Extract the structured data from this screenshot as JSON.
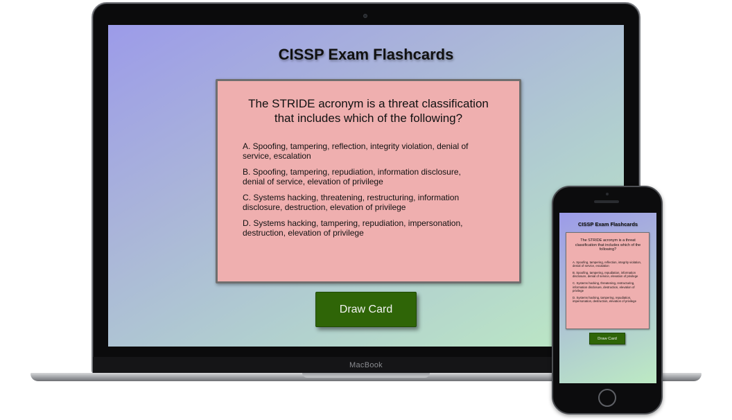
{
  "device_labels": {
    "laptop_brand": "MacBook"
  },
  "app": {
    "title": "CISSP Exam Flashcards",
    "card": {
      "question": "The STRIDE acronym is a threat classification that includes which of the following?",
      "options": [
        "A. Spoofing, tampering, reflection, integrity violation, denial of service, escalation",
        "B. Spoofing, tampering, repudiation, information disclosure, denial of service, elevation of privilege",
        "C. Systems hacking, threatening, restructuring, information disclosure, destruction, elevation of privilege",
        "D. Systems hacking, tampering, repudiation, impersonation, destruction, elevation of privilege"
      ]
    },
    "draw_button_label": "Draw Card"
  },
  "colors": {
    "card_bg": "#efafaf",
    "button_bg": "#2f6507",
    "gradient_start": "#9c9be9",
    "gradient_end": "#bdeac3"
  }
}
